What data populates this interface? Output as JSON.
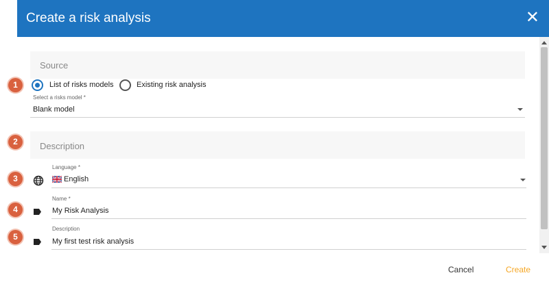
{
  "dialog": {
    "title": "Create a risk analysis",
    "close_glyph": "✕"
  },
  "source": {
    "heading": "Source",
    "badge": "1",
    "options": [
      {
        "label": "List of risks models",
        "checked": true
      },
      {
        "label": "Existing risk analysis",
        "checked": false
      }
    ],
    "model_select": {
      "label": "Select a risks model *",
      "value": "Blank model"
    }
  },
  "description_section": {
    "heading": "Description",
    "badge": "2"
  },
  "language": {
    "badge": "3",
    "label": "Language *",
    "value": "English",
    "icon": "globe-icon",
    "flag": "uk-flag-icon"
  },
  "name": {
    "badge": "4",
    "label": "Name *",
    "value": "My Risk Analysis",
    "icon": "tag-icon"
  },
  "description": {
    "badge": "5",
    "label": "Description",
    "value": "My first test risk analysis",
    "icon": "tag-icon"
  },
  "footer": {
    "cancel_label": "Cancel",
    "create_label": "Create"
  },
  "colors": {
    "header": "#1e74c0",
    "badge": "#d9613f",
    "create": "#f5a623"
  }
}
